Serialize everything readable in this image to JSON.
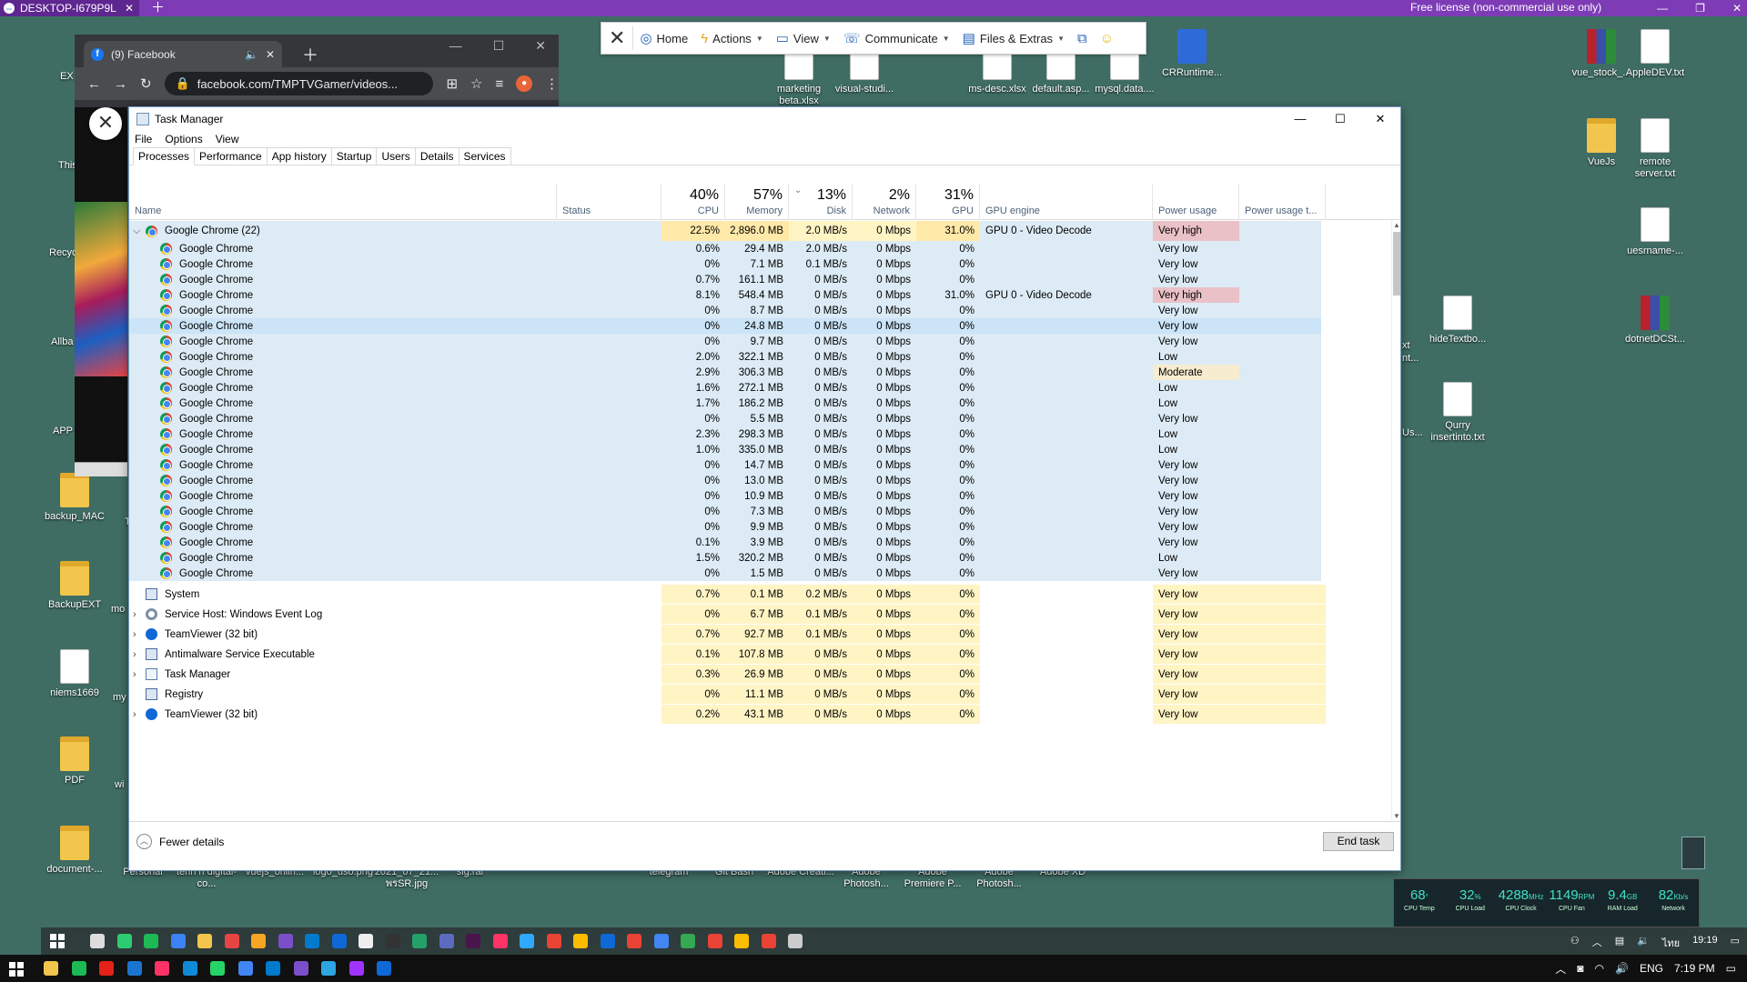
{
  "teamviewer": {
    "tab_title": "DESKTOP-I679P9L",
    "license": "Free license (non-commercial use only)",
    "toolbar": {
      "home": "Home",
      "actions": "Actions",
      "view": "View",
      "communicate": "Communicate",
      "files": "Files & Extras"
    }
  },
  "chrome": {
    "tab_title": "(9) Facebook",
    "url": "facebook.com/TMPTVGamer/videos..."
  },
  "desktop_icons": [
    {
      "label": "vue_stock_...",
      "type": "rar"
    },
    {
      "label": "AppleDEV.txt",
      "type": "doc"
    },
    {
      "label": "VueJs",
      "type": "folder"
    },
    {
      "label": "remote server.txt",
      "type": "doc"
    },
    {
      "label": "uesrname-...",
      "type": "doc"
    },
    {
      "label": "dotnetDCSt...",
      "type": "rar"
    },
    {
      "label": "hideTextbo...",
      "type": "doc"
    },
    {
      "label": "Qurry insertinto.txt",
      "type": "doc"
    },
    {
      "label": "backup_MAC",
      "type": "folder"
    },
    {
      "label": "BackupEXT",
      "type": "folder"
    },
    {
      "label": "niems1669",
      "type": "doc"
    },
    {
      "label": "PDF",
      "type": "folder"
    },
    {
      "label": "document-...",
      "type": "folder"
    },
    {
      "label": "marketing beta.xlsx",
      "type": "doc"
    },
    {
      "label": "visual-studi...",
      "type": "doc"
    },
    {
      "label": "ms-desc.xlsx",
      "type": "doc"
    },
    {
      "label": "default.asp...",
      "type": "doc"
    },
    {
      "label": "mysql.data....",
      "type": "doc"
    },
    {
      "label": "CRRuntime...",
      "type": "blue"
    }
  ],
  "desktop_partial_labels": [
    "EX",
    "This",
    "Recyc",
    "Allba",
    "APP",
    "T",
    "mo",
    "my",
    "wi",
    "xt",
    "nt...",
    "Us..."
  ],
  "bottom_labels": [
    "Personal",
    "tenn n digital-co...",
    "vuejs_onlin...",
    "logo_uso.png",
    "2021_07_21... พรSR.jpg",
    "sig.rar",
    "telegram",
    "Git Bash",
    "Adobe Creati...",
    "Adobe Photosh...",
    "Adobe Premiere P...",
    "Adobe Photosh...",
    "Adobe XD"
  ],
  "task_manager": {
    "title": "Task Manager",
    "menu": [
      "File",
      "Options",
      "View"
    ],
    "tabs": [
      "Processes",
      "Performance",
      "App history",
      "Startup",
      "Users",
      "Details",
      "Services"
    ],
    "active_tab": "Processes",
    "headers": {
      "name": "Name",
      "status": "Status",
      "cpu_pct": "40%",
      "cpu": "CPU",
      "memory_pct": "57%",
      "memory": "Memory",
      "disk_pct": "13%",
      "disk": "Disk",
      "network_pct": "2%",
      "network": "Network",
      "gpu_pct": "31%",
      "gpu": "GPU",
      "gpu_engine": "GPU engine",
      "power": "Power usage",
      "power_trend": "Power usage t..."
    },
    "group": {
      "name": "Google Chrome (22)",
      "cpu": "22.5%",
      "memory": "2,896.0 MB",
      "disk": "2.0 MB/s",
      "network": "0 Mbps",
      "gpu": "31.0%",
      "gpu_engine": "GPU 0 - Video Decode",
      "power": "Very high"
    },
    "children": [
      {
        "name": "Google Chrome",
        "cpu": "0.6%",
        "memory": "29.4 MB",
        "disk": "2.0 MB/s",
        "network": "0 Mbps",
        "gpu": "0%",
        "gpu_engine": "",
        "power": "Very low"
      },
      {
        "name": "Google Chrome",
        "cpu": "0%",
        "memory": "7.1 MB",
        "disk": "0.1 MB/s",
        "network": "0 Mbps",
        "gpu": "0%",
        "gpu_engine": "",
        "power": "Very low"
      },
      {
        "name": "Google Chrome",
        "cpu": "0.7%",
        "memory": "161.1 MB",
        "disk": "0 MB/s",
        "network": "0 Mbps",
        "gpu": "0%",
        "gpu_engine": "",
        "power": "Very low"
      },
      {
        "name": "Google Chrome",
        "cpu": "8.1%",
        "memory": "548.4 MB",
        "disk": "0 MB/s",
        "network": "0 Mbps",
        "gpu": "31.0%",
        "gpu_engine": "GPU 0 - Video Decode",
        "power": "Very high"
      },
      {
        "name": "Google Chrome",
        "cpu": "0%",
        "memory": "8.7 MB",
        "disk": "0 MB/s",
        "network": "0 Mbps",
        "gpu": "0%",
        "gpu_engine": "",
        "power": "Very low"
      },
      {
        "name": "Google Chrome",
        "cpu": "0%",
        "memory": "24.8 MB",
        "disk": "0 MB/s",
        "network": "0 Mbps",
        "gpu": "0%",
        "gpu_engine": "",
        "power": "Very low"
      },
      {
        "name": "Google Chrome",
        "cpu": "0%",
        "memory": "9.7 MB",
        "disk": "0 MB/s",
        "network": "0 Mbps",
        "gpu": "0%",
        "gpu_engine": "",
        "power": "Very low"
      },
      {
        "name": "Google Chrome",
        "cpu": "2.0%",
        "memory": "322.1 MB",
        "disk": "0 MB/s",
        "network": "0 Mbps",
        "gpu": "0%",
        "gpu_engine": "",
        "power": "Low"
      },
      {
        "name": "Google Chrome",
        "cpu": "2.9%",
        "memory": "306.3 MB",
        "disk": "0 MB/s",
        "network": "0 Mbps",
        "gpu": "0%",
        "gpu_engine": "",
        "power": "Moderate"
      },
      {
        "name": "Google Chrome",
        "cpu": "1.6%",
        "memory": "272.1 MB",
        "disk": "0 MB/s",
        "network": "0 Mbps",
        "gpu": "0%",
        "gpu_engine": "",
        "power": "Low"
      },
      {
        "name": "Google Chrome",
        "cpu": "1.7%",
        "memory": "186.2 MB",
        "disk": "0 MB/s",
        "network": "0 Mbps",
        "gpu": "0%",
        "gpu_engine": "",
        "power": "Low"
      },
      {
        "name": "Google Chrome",
        "cpu": "0%",
        "memory": "5.5 MB",
        "disk": "0 MB/s",
        "network": "0 Mbps",
        "gpu": "0%",
        "gpu_engine": "",
        "power": "Very low"
      },
      {
        "name": "Google Chrome",
        "cpu": "2.3%",
        "memory": "298.3 MB",
        "disk": "0 MB/s",
        "network": "0 Mbps",
        "gpu": "0%",
        "gpu_engine": "",
        "power": "Low"
      },
      {
        "name": "Google Chrome",
        "cpu": "1.0%",
        "memory": "335.0 MB",
        "disk": "0 MB/s",
        "network": "0 Mbps",
        "gpu": "0%",
        "gpu_engine": "",
        "power": "Low"
      },
      {
        "name": "Google Chrome",
        "cpu": "0%",
        "memory": "14.7 MB",
        "disk": "0 MB/s",
        "network": "0 Mbps",
        "gpu": "0%",
        "gpu_engine": "",
        "power": "Very low"
      },
      {
        "name": "Google Chrome",
        "cpu": "0%",
        "memory": "13.0 MB",
        "disk": "0 MB/s",
        "network": "0 Mbps",
        "gpu": "0%",
        "gpu_engine": "",
        "power": "Very low"
      },
      {
        "name": "Google Chrome",
        "cpu": "0%",
        "memory": "10.9 MB",
        "disk": "0 MB/s",
        "network": "0 Mbps",
        "gpu": "0%",
        "gpu_engine": "",
        "power": "Very low"
      },
      {
        "name": "Google Chrome",
        "cpu": "0%",
        "memory": "7.3 MB",
        "disk": "0 MB/s",
        "network": "0 Mbps",
        "gpu": "0%",
        "gpu_engine": "",
        "power": "Very low"
      },
      {
        "name": "Google Chrome",
        "cpu": "0%",
        "memory": "9.9 MB",
        "disk": "0 MB/s",
        "network": "0 Mbps",
        "gpu": "0%",
        "gpu_engine": "",
        "power": "Very low"
      },
      {
        "name": "Google Chrome",
        "cpu": "0.1%",
        "memory": "3.9 MB",
        "disk": "0 MB/s",
        "network": "0 Mbps",
        "gpu": "0%",
        "gpu_engine": "",
        "power": "Very low"
      },
      {
        "name": "Google Chrome",
        "cpu": "1.5%",
        "memory": "320.2 MB",
        "disk": "0 MB/s",
        "network": "0 Mbps",
        "gpu": "0%",
        "gpu_engine": "",
        "power": "Low"
      },
      {
        "name": "Google Chrome",
        "cpu": "0%",
        "memory": "1.5 MB",
        "disk": "0 MB/s",
        "network": "0 Mbps",
        "gpu": "0%",
        "gpu_engine": "",
        "power": "Very low"
      }
    ],
    "others": [
      {
        "name": "System",
        "icon": "win",
        "expandable": false,
        "cpu": "0.7%",
        "memory": "0.1 MB",
        "disk": "0.2 MB/s",
        "network": "0 Mbps",
        "gpu": "0%",
        "gpu_engine": "",
        "power": "Very low"
      },
      {
        "name": "Service Host: Windows Event Log",
        "icon": "gear",
        "expandable": true,
        "cpu": "0%",
        "memory": "6.7 MB",
        "disk": "0.1 MB/s",
        "network": "0 Mbps",
        "gpu": "0%",
        "gpu_engine": "",
        "power": "Very low"
      },
      {
        "name": "TeamViewer (32 bit)",
        "icon": "tv",
        "expandable": true,
        "cpu": "0.7%",
        "memory": "92.7 MB",
        "disk": "0.1 MB/s",
        "network": "0 Mbps",
        "gpu": "0%",
        "gpu_engine": "",
        "power": "Very low"
      },
      {
        "name": "Antimalware Service Executable",
        "icon": "win",
        "expandable": true,
        "cpu": "0.1%",
        "memory": "107.8 MB",
        "disk": "0 MB/s",
        "network": "0 Mbps",
        "gpu": "0%",
        "gpu_engine": "",
        "power": "Very low"
      },
      {
        "name": "Task Manager",
        "icon": "tm",
        "expandable": true,
        "cpu": "0.3%",
        "memory": "26.9 MB",
        "disk": "0 MB/s",
        "network": "0 Mbps",
        "gpu": "0%",
        "gpu_engine": "",
        "power": "Very low"
      },
      {
        "name": "Registry",
        "icon": "win",
        "expandable": false,
        "cpu": "0%",
        "memory": "11.1 MB",
        "disk": "0 MB/s",
        "network": "0 Mbps",
        "gpu": "0%",
        "gpu_engine": "",
        "power": "Very low"
      },
      {
        "name": "TeamViewer (32 bit)",
        "icon": "tv",
        "expandable": true,
        "cpu": "0.2%",
        "memory": "43.1 MB",
        "disk": "0 MB/s",
        "network": "0 Mbps",
        "gpu": "0%",
        "gpu_engine": "",
        "power": "Very low"
      }
    ],
    "footer": {
      "fewer_details": "Fewer details",
      "end_task": "End task"
    }
  },
  "hw_monitor": [
    {
      "value": "68",
      "unit": "°",
      "caption": "CPU Temp"
    },
    {
      "value": "32",
      "unit": "%",
      "caption": "CPU Load"
    },
    {
      "value": "4288",
      "unit": "MHz",
      "caption": "CPU Clock"
    },
    {
      "value": "1149",
      "unit": "RPM",
      "caption": "CPU Fan"
    },
    {
      "value": "9.4",
      "unit": "GB",
      "caption": "RAM Load"
    },
    {
      "value": "82",
      "unit": "Kb/s",
      "caption": "Network"
    }
  ],
  "remote_taskbar": {
    "time": "19:19",
    "lang": "ไทย"
  },
  "local_taskbar": {
    "lang": "ENG",
    "time": "7:19 PM"
  },
  "colors": {
    "chrome_row_bg": "#dcebf5",
    "selected_row_bg": "#cce4f7",
    "heat_light": "#fff4c4",
    "heat_mid": "#ffe9a8",
    "power_very_high": "#e9c1c6",
    "power_moderate": "#f7ecd0"
  }
}
